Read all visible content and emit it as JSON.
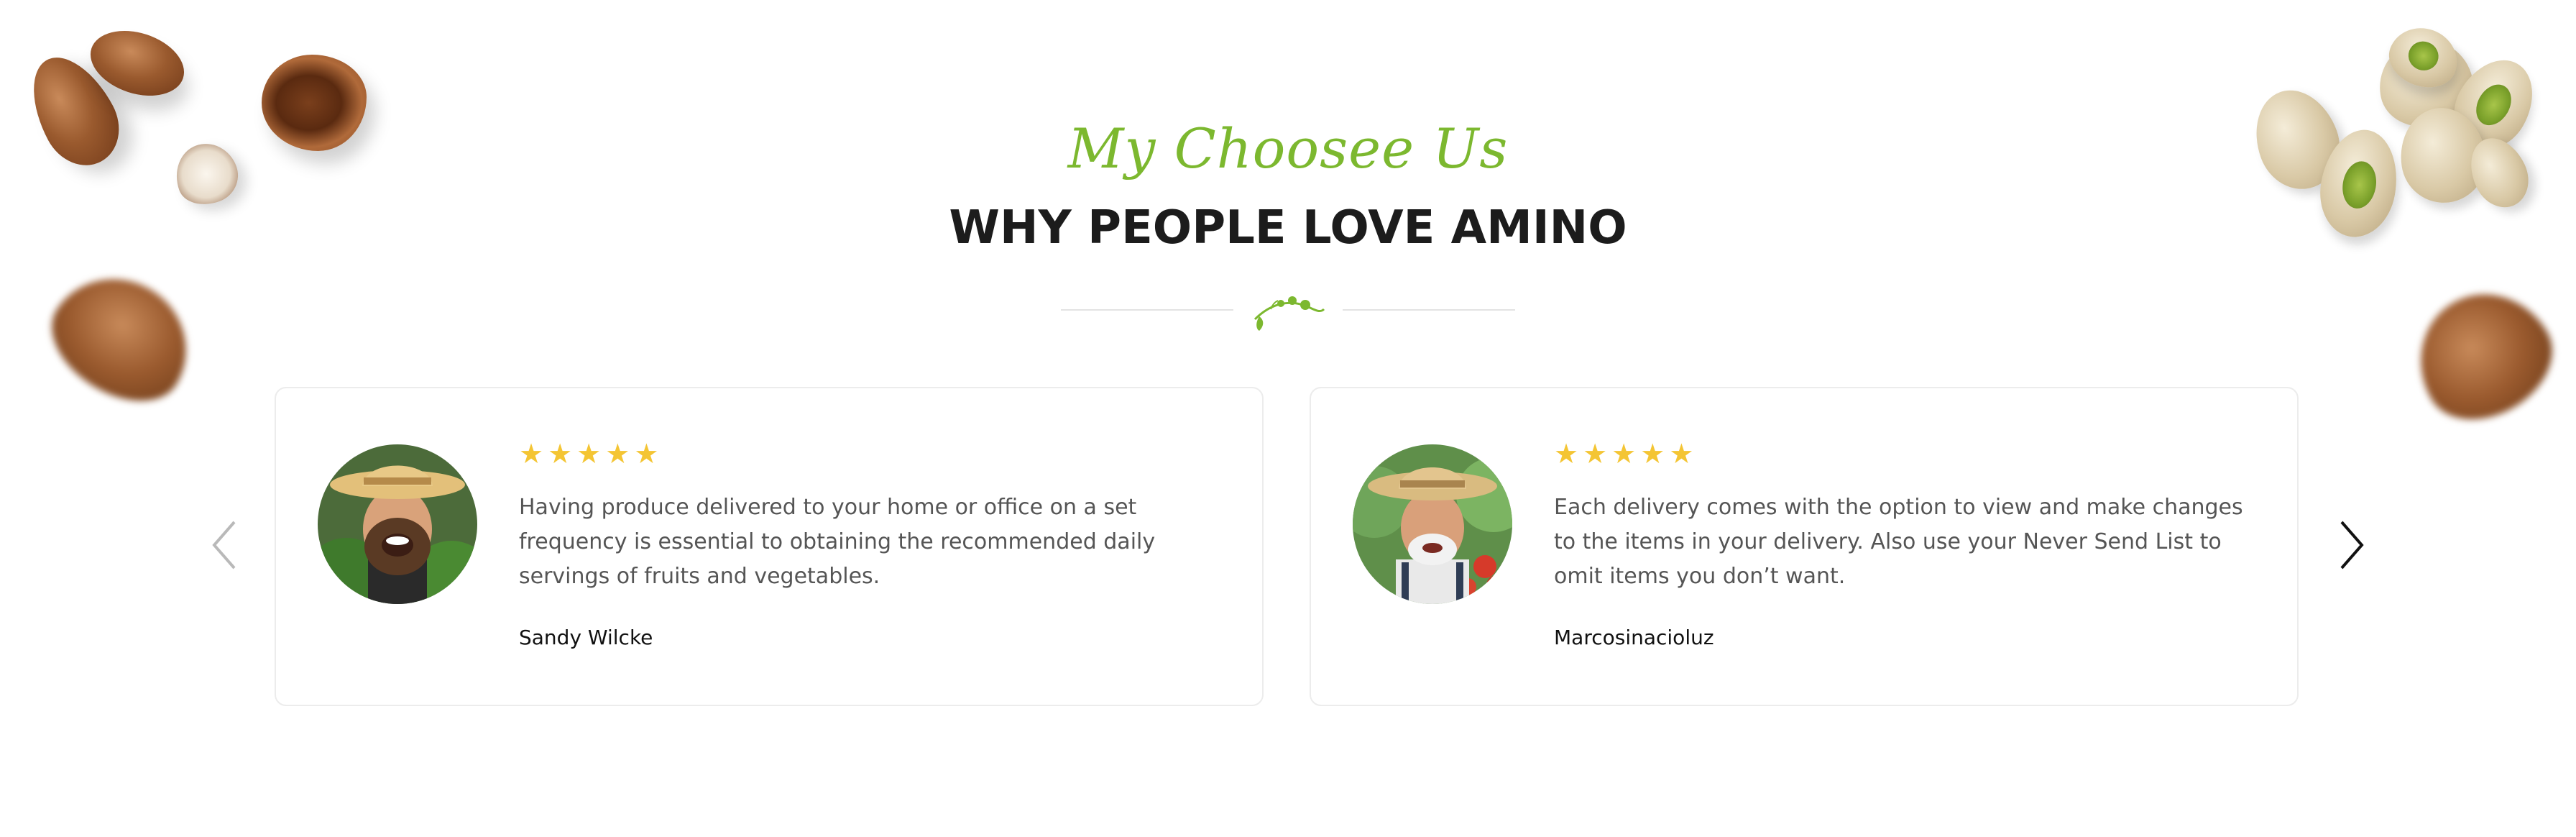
{
  "section": {
    "subtitle": "My Choosee Us",
    "title": "WHY PEOPLE LOVE AMINO"
  },
  "colors": {
    "accent_green": "#7cb82f",
    "star_yellow": "#f4c534",
    "title_dark": "#1c1c1c",
    "body_text": "#555555"
  },
  "slider": {
    "prev_icon": "chevron-left-icon",
    "next_icon": "chevron-right-icon"
  },
  "testimonials": [
    {
      "rating": 5,
      "stars": [
        "★",
        "★",
        "★",
        "★",
        "★"
      ],
      "text": "Having produce delivered to your home or office on a set frequency is essential to obtaining the recommended daily servings of fruits and vegetables.",
      "author": "Sandy Wilcke",
      "avatar_icon": "farmer-avatar"
    },
    {
      "rating": 5,
      "stars": [
        "★",
        "★",
        "★",
        "★",
        "★"
      ],
      "text": "Each delivery comes with the option to view and make changes to the items in your delivery. Also use your Never Send List to omit items you don’t want.",
      "author": "Marcosinacioluz",
      "avatar_icon": "elderly-farmer-avatar"
    }
  ]
}
